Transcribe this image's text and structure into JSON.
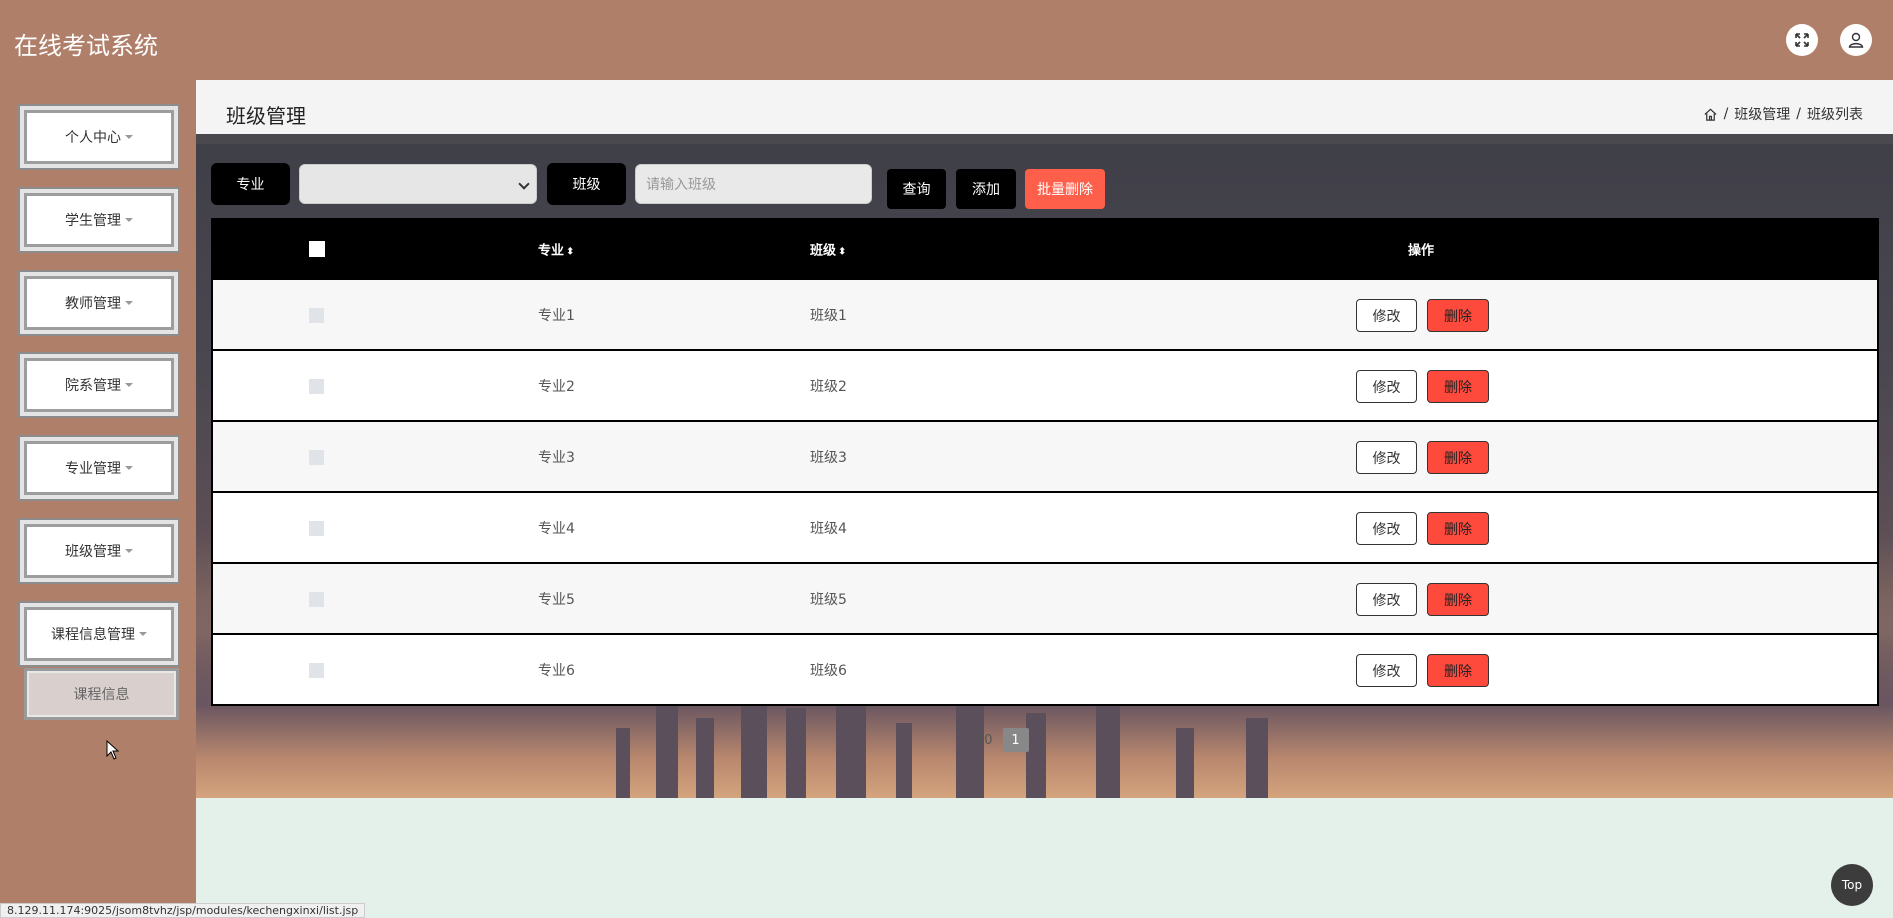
{
  "app": {
    "title": "在线考试系统"
  },
  "header": {
    "fullscreen_icon": "expand-icon",
    "user_icon": "user-icon"
  },
  "sidebar": {
    "items": [
      {
        "label": "个人中心"
      },
      {
        "label": "学生管理"
      },
      {
        "label": "教师管理"
      },
      {
        "label": "院系管理"
      },
      {
        "label": "专业管理"
      },
      {
        "label": "班级管理"
      },
      {
        "label": "课程信息管理"
      }
    ],
    "submenu": {
      "label": "课程信息"
    }
  },
  "page": {
    "title": "班级管理",
    "breadcrumb": [
      "班级管理",
      "班级列表"
    ]
  },
  "search": {
    "major_label": "专业",
    "major_value": "",
    "class_label": "班级",
    "class_placeholder": "请输入班级",
    "query_button": "查询",
    "add_button": "添加",
    "batch_delete_button": "批量删除"
  },
  "table": {
    "headers": {
      "major": "专业",
      "class": "班级",
      "actions": "操作"
    },
    "rows": [
      {
        "major": "专业1",
        "class": "班级1"
      },
      {
        "major": "专业2",
        "class": "班级2"
      },
      {
        "major": "专业3",
        "class": "班级3"
      },
      {
        "major": "专业4",
        "class": "班级4"
      },
      {
        "major": "专业5",
        "class": "班级5"
      },
      {
        "major": "专业6",
        "class": "班级6"
      }
    ],
    "edit_label": "修改",
    "delete_label": "删除"
  },
  "pagination": {
    "page_size": "10",
    "current_page": "1"
  },
  "status_url": "8.129.11.174:9025/jsom8tvhz/jsp/modules/kechengxinxi/list.jsp",
  "top_button": "Top",
  "colors": {
    "topbar": "#b07f6a",
    "delete": "#fe4a3c",
    "batch_delete": "#fe5f4b",
    "dark": "#000000"
  }
}
